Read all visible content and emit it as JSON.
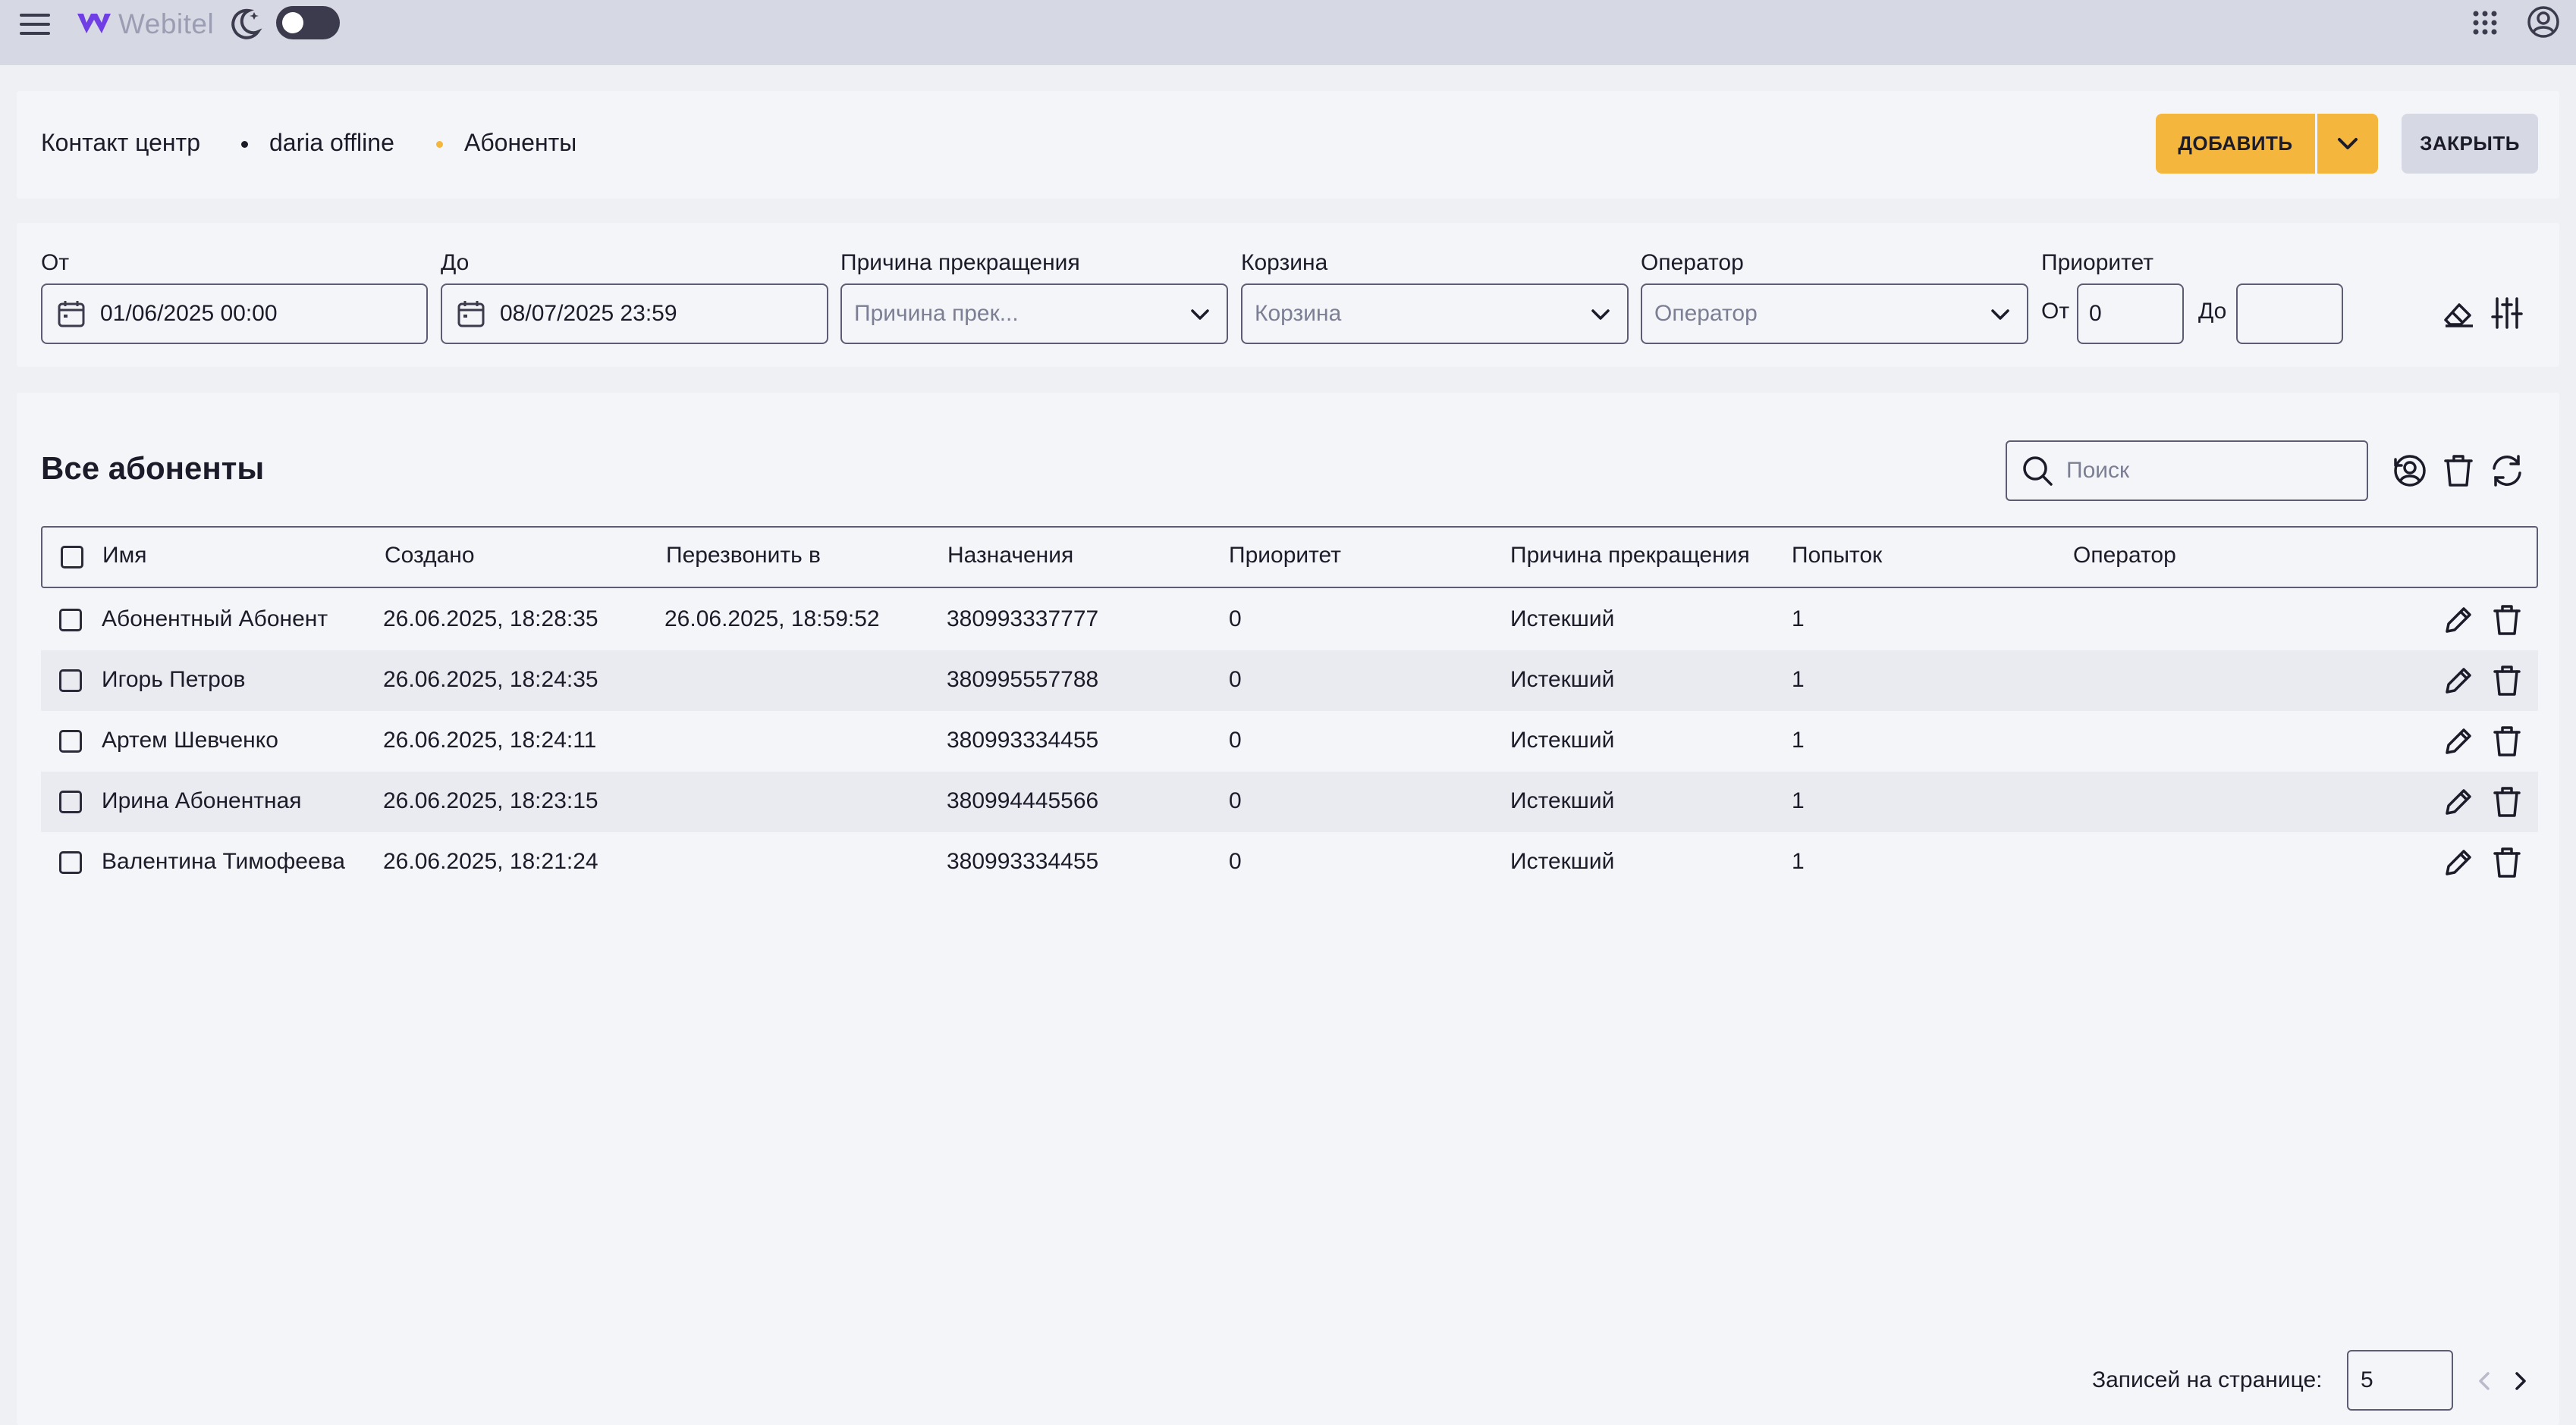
{
  "app": {
    "logo_text": "Webitel",
    "logo_color": "#6f3fe5",
    "accent": "#f4b63c"
  },
  "breadcrumb": {
    "items": [
      "Контакт центр",
      "daria offline",
      "Абоненты"
    ],
    "active_dot_color": "#f4b63c"
  },
  "header": {
    "add_label": "ДОБАВИТЬ",
    "close_label": "ЗАКРЫТЬ"
  },
  "filters": {
    "from": {
      "label": "От",
      "value": "01/06/2025 00:00"
    },
    "to": {
      "label": "До",
      "value": "08/07/2025 23:59"
    },
    "reason": {
      "label": "Причина прекращения",
      "placeholder": "Причина прек..."
    },
    "bucket": {
      "label": "Корзина",
      "placeholder": "Корзина"
    },
    "operator": {
      "label": "Оператор",
      "placeholder": "Оператор"
    },
    "priority": {
      "label": "Приоритет",
      "from_label": "От",
      "from_value": "0",
      "to_label": "До",
      "to_value": ""
    }
  },
  "main": {
    "title": "Все абоненты",
    "search_placeholder": "Поиск"
  },
  "table": {
    "columns": [
      "Имя",
      "Создано",
      "Перезвонить в",
      "Назначения",
      "Приоритет",
      "Причина прекращения",
      "Попыток",
      "Оператор"
    ],
    "rows": [
      {
        "name": "Абонентный Абонент",
        "created": "26.06.2025, 18:28:35",
        "callback": "26.06.2025, 18:59:52",
        "destination": "380993337777",
        "priority": "0",
        "reason": "Истекший",
        "attempts": "1",
        "operator": ""
      },
      {
        "name": "Игорь Петров",
        "created": "26.06.2025, 18:24:35",
        "callback": "",
        "destination": "380995557788",
        "priority": "0",
        "reason": "Истекший",
        "attempts": "1",
        "operator": ""
      },
      {
        "name": "Артем Шевченко",
        "created": "26.06.2025, 18:24:11",
        "callback": "",
        "destination": "380993334455",
        "priority": "0",
        "reason": "Истекший",
        "attempts": "1",
        "operator": ""
      },
      {
        "name": "Ирина Абонентная",
        "created": "26.06.2025, 18:23:15",
        "callback": "",
        "destination": "380994445566",
        "priority": "0",
        "reason": "Истекший",
        "attempts": "1",
        "operator": ""
      },
      {
        "name": "Валентина Тимофеева",
        "created": "26.06.2025, 18:21:24",
        "callback": "",
        "destination": "380993334455",
        "priority": "0",
        "reason": "Истекший",
        "attempts": "1",
        "operator": ""
      }
    ]
  },
  "pagination": {
    "per_page_label": "Записей на странице:",
    "per_page_value": "5"
  }
}
